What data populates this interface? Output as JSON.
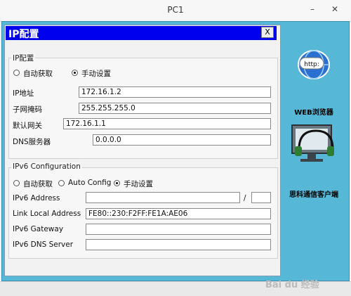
{
  "window": {
    "title": "PC1",
    "minimize": "–",
    "close": "✕"
  },
  "dialog": {
    "title": "IP配置",
    "close_label": "X"
  },
  "ipv4": {
    "section_title": "IP配置",
    "mode_dhcp": "自动获取",
    "mode_static": "手动设置",
    "selected_mode": "手动设置",
    "ip_label": "IP地址",
    "ip_value": "172.16.1.2",
    "mask_label": "子网掩码",
    "mask_value": "255.255.255.0",
    "gateway_label": "默认网关",
    "gateway_value": "172.16.1.1",
    "dns_label": "DNS服务器",
    "dns_value": "0.0.0.0"
  },
  "ipv6": {
    "section_title": "IPv6 Configuration",
    "mode_dhcp": "自动获取",
    "mode_auto": "Auto Config",
    "mode_static": "手动设置",
    "selected_mode": "手动设置",
    "address_label": "IPv6 Address",
    "address_value": "",
    "prefix_sep": "/",
    "prefix_value": "",
    "link_local_label": "Link Local Address",
    "link_local_value": "FE80::230:F2FF:FE1A:AE06",
    "gateway_label": "IPv6 Gateway",
    "gateway_value": "",
    "dns_label": "IPv6 DNS Server",
    "dns_value": ""
  },
  "side_apps": [
    {
      "label": "WEB浏览器",
      "icon": "web-browser-icon",
      "icon_text": "http:"
    },
    {
      "label": "思科通信客户端",
      "icon": "cisco-ip-communicator-icon"
    }
  ],
  "watermark": "Bai du 经验",
  "colors": {
    "dialog_title": "#0000ee",
    "panel": "#56b7d6"
  }
}
